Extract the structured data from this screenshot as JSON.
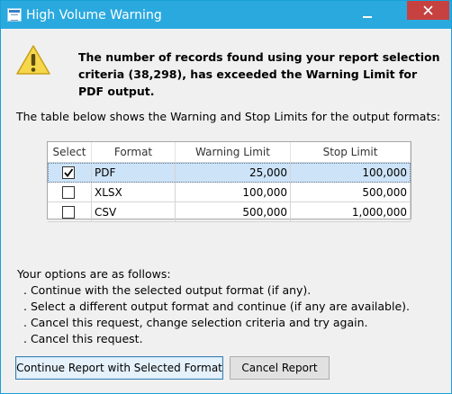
{
  "window": {
    "title": "High Volume Warning",
    "close_glyph": "×",
    "colors": {
      "titlebar": "#2aa9df",
      "close": "#c84141"
    }
  },
  "message": {
    "icon": "warning-icon",
    "headline": "The number of records found using your report selection criteria (38,298), has exceeded the Warning Limit for PDF output.",
    "intro": "The table below shows the Warning and Stop Limits for the output formats:"
  },
  "table": {
    "columns": [
      "Select",
      "Format",
      "Warning Limit",
      "Stop Limit"
    ],
    "rows": [
      {
        "selected": true,
        "format": "PDF",
        "warning": "25,000",
        "stop": "100,000"
      },
      {
        "selected": false,
        "format": "XLSX",
        "warning": "100,000",
        "stop": "500,000"
      },
      {
        "selected": false,
        "format": "CSV",
        "warning": "500,000",
        "stop": "1,000,000"
      }
    ]
  },
  "options": {
    "heading": "Your options are as follows:",
    "items": [
      ".  Continue with the selected output format (if any).",
      ".  Select a different output format and continue (if any are available).",
      ".  Cancel this request, change selection criteria and try again.",
      ".  Cancel this request."
    ]
  },
  "buttons": {
    "continue": "Continue Report with Selected Format",
    "cancel": "Cancel Report"
  }
}
